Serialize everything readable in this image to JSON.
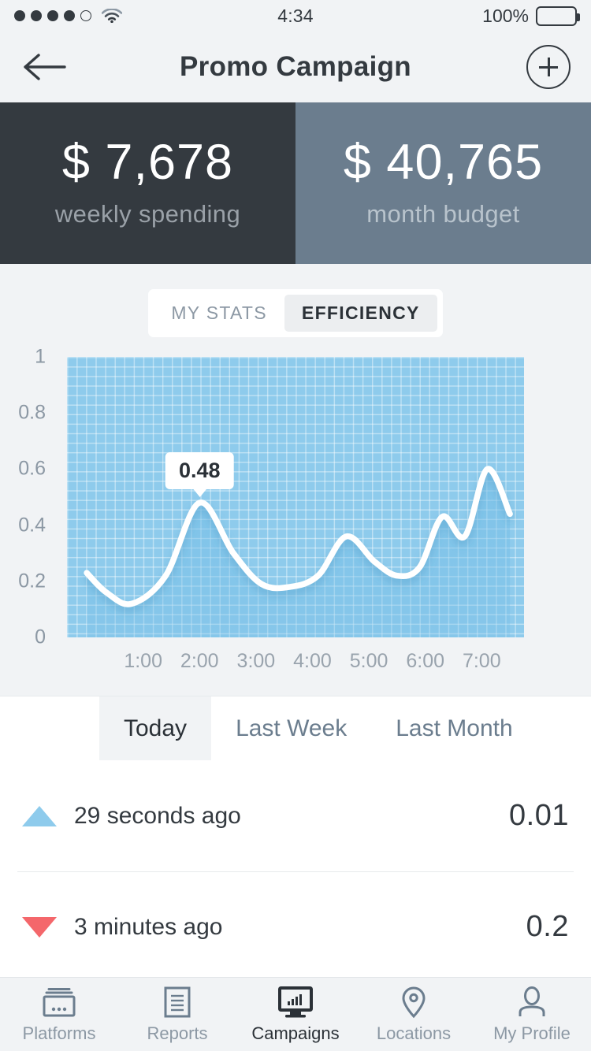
{
  "status_bar": {
    "signal_dots_filled": 4,
    "signal_dots_total": 5,
    "wifi_icon": "wifi-icon",
    "time": "4:34",
    "battery_percent": "100%",
    "battery_level": 100
  },
  "nav": {
    "back_icon": "arrow-left-icon",
    "title": "Promo Campaign",
    "add_icon": "plus-circle-icon"
  },
  "cards": [
    {
      "value": "$ 7,678",
      "label": "weekly spending",
      "bg": "#343a40"
    },
    {
      "value": "$ 40,765",
      "label": "month budget",
      "bg": "#6b7d8e"
    }
  ],
  "segmented": {
    "options": [
      "MY STATS",
      "EFFICIENCY"
    ],
    "selected": "EFFICIENCY"
  },
  "chart_data": {
    "type": "area",
    "title": "",
    "xlabel": "",
    "ylabel": "",
    "ylim": [
      0,
      1
    ],
    "yticks": [
      "0",
      "0.2",
      "0.4",
      "0.6",
      "0.8",
      "1"
    ],
    "ytick_values": [
      0,
      0.2,
      0.4,
      0.6,
      0.8,
      1
    ],
    "xticks": [
      "1:00",
      "2:00",
      "3:00",
      "4:00",
      "5:00",
      "6:00",
      "7:00"
    ],
    "grid": true,
    "legend": "none",
    "line_color": "#ffffff",
    "fill_color": "#8ecbec",
    "x": [
      0.0,
      0.35,
      0.8,
      1.4,
      2.0,
      2.6,
      3.1,
      3.6,
      4.1,
      4.6,
      5.1,
      5.5,
      5.9,
      6.3,
      6.7,
      7.1,
      7.5
    ],
    "values": [
      0.23,
      0.16,
      0.12,
      0.22,
      0.48,
      0.3,
      0.19,
      0.18,
      0.22,
      0.36,
      0.27,
      0.22,
      0.25,
      0.43,
      0.36,
      0.6,
      0.44
    ],
    "annotations": [
      {
        "label": "0.48",
        "x": "2:00",
        "y": 0.48
      }
    ]
  },
  "period_tabs": {
    "items": [
      "Today",
      "Last Week",
      "Last Month"
    ],
    "selected": "Today"
  },
  "list": [
    {
      "direction": "up",
      "icon": "triangle-up-icon",
      "label": "29 seconds ago",
      "value": "0.01",
      "color": "#8ecbec"
    },
    {
      "direction": "down",
      "icon": "triangle-down-icon",
      "label": "3 minutes ago",
      "value": "0.2",
      "color": "#f4676b"
    }
  ],
  "tabbar": {
    "items": [
      {
        "label": "Platforms",
        "icon": "platforms-icon",
        "active": false
      },
      {
        "label": "Reports",
        "icon": "reports-icon",
        "active": false
      },
      {
        "label": "Campaigns",
        "icon": "campaigns-icon",
        "active": true
      },
      {
        "label": "Locations",
        "icon": "location-pin-icon",
        "active": false
      },
      {
        "label": "My Profile",
        "icon": "user-icon",
        "active": false
      }
    ]
  },
  "colors": {
    "background": "#f1f3f5",
    "dark": "#343a40",
    "muted": "#6b7d8e",
    "accent_blue": "#8ecbec",
    "accent_red": "#f4676b"
  }
}
